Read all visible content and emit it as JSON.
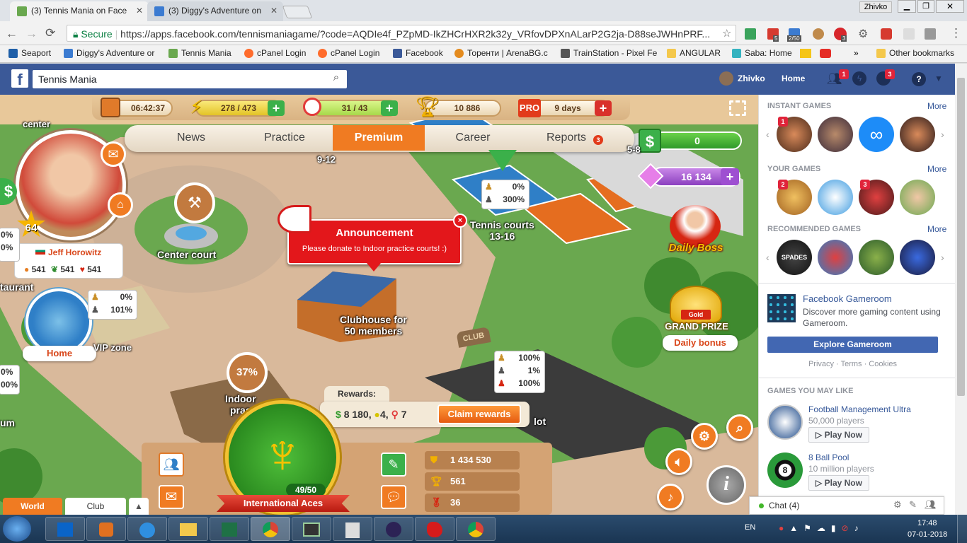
{
  "browser": {
    "tabs": [
      {
        "title": "(3) Tennis Mania on Face"
      },
      {
        "title": "(3) Diggy's Adventure on"
      }
    ],
    "user_badge": "Zhivko",
    "secure_label": "Secure",
    "url": "https://apps.facebook.com/tennismaniagame/?code=AQDIe4f_PZpMD-IkZHCrHXR2k32y_VRfovDPXnALarP2G2ja-D88seJWHnPRF...",
    "bookmarks": [
      {
        "label": "Seaport"
      },
      {
        "label": "Diggy's Adventure or"
      },
      {
        "label": "Tennis Mania"
      },
      {
        "label": "cPanel Login"
      },
      {
        "label": "cPanel Login"
      },
      {
        "label": "Facebook"
      },
      {
        "label": "Торенти | ArenaBG.c"
      },
      {
        "label": "TrainStation - Pixel Fe"
      },
      {
        "label": "ANGULAR"
      },
      {
        "label": "Saba: Home"
      }
    ],
    "other_bookmarks": "Other bookmarks",
    "ext_badges": {
      "b1": "5",
      "b2": "2/50",
      "b3": "3"
    }
  },
  "facebook": {
    "search_value": "Tennis Mania",
    "user_name": "Zhivko",
    "home": "Home",
    "friend_badge": "1",
    "notif_badge": "3"
  },
  "game": {
    "top": {
      "timer": "06:42:37",
      "energy": "278 / 473",
      "rackets": "31 / 43",
      "trophies": "10 886",
      "pro_label": "PRO",
      "pro_days": "9 days"
    },
    "nav": {
      "news": "News",
      "practice": "Practice",
      "premium": "Premium",
      "career": "Career",
      "reports": "Reports",
      "reports_badge": "3"
    },
    "cash": "0",
    "gems": "16 134",
    "player": {
      "level": "64",
      "name": "Jeff Horowitz",
      "stats": [
        "541",
        "541",
        "541"
      ]
    },
    "home_label": "Home",
    "announcement": {
      "title": "Announcement",
      "text": "Please donate to Indoor practice courts! :)"
    },
    "map": {
      "center": "center",
      "center_court": "Center court",
      "taurant": "taurant",
      "vip": "VIP zone",
      "clubhouse": "Clubhouse for\n50 members",
      "tennis_courts": "Tennis courts\n13-16",
      "courts_9_12": "9-12",
      "courts_58": "5-8",
      "indoor": "Indoor\nprac",
      "indoor_pct": "37%",
      "lot": "lot",
      "um": "um",
      "club": "CLUB"
    },
    "cards": {
      "c1": [
        "0%",
        "300%"
      ],
      "c2": [
        "0%",
        "101%"
      ],
      "c3": [
        "100%",
        "1%",
        "100%"
      ],
      "c_left": [
        "0%",
        "0%"
      ],
      "c_left2": [
        "0%",
        "00%"
      ]
    },
    "daily_boss": "Daily Boss",
    "grand_prize": {
      "gold": "Gold",
      "title": "GRAND PRIZE",
      "bonus": "Daily bonus"
    },
    "rewards": {
      "label": "Rewards:",
      "money": "8 180,",
      "balls": "4,",
      "rackets": "7",
      "claim": "Claim rewards"
    },
    "club": {
      "members": "49/50",
      "name": "International Aces"
    },
    "bottom_stats": [
      "1 434 530",
      "561",
      "36"
    ],
    "tabs": {
      "world": "World",
      "club": "Club"
    }
  },
  "sidebar": {
    "instant_games": "INSTANT GAMES",
    "your_games": "YOUR GAMES",
    "recommended": "RECOMMENDED GAMES",
    "more": "More",
    "instant_badge": "1",
    "your_badges": [
      "2",
      "3"
    ],
    "spades": "SPADES",
    "gameroom_title": "Facebook Gameroom",
    "gameroom_desc": "Discover more gaming content using Gameroom.",
    "explore": "Explore Gameroom",
    "footer": "Privacy · Terms · Cookies",
    "may_like": "GAMES YOU MAY LIKE",
    "games": [
      {
        "name": "Football Management Ultra",
        "players": "50,000 players",
        "btn": "Play Now"
      },
      {
        "name": "8 Ball Pool",
        "players": "10 million players",
        "btn": "Play Now"
      }
    ],
    "chat": "Chat (4)"
  },
  "taskbar": {
    "lang": "EN",
    "time": "17:48",
    "date": "07-01-2018"
  },
  "colors": {
    "fb_blue": "#3b5998",
    "premium_orange": "#f07b22",
    "announcement_red": "#e3171b"
  }
}
